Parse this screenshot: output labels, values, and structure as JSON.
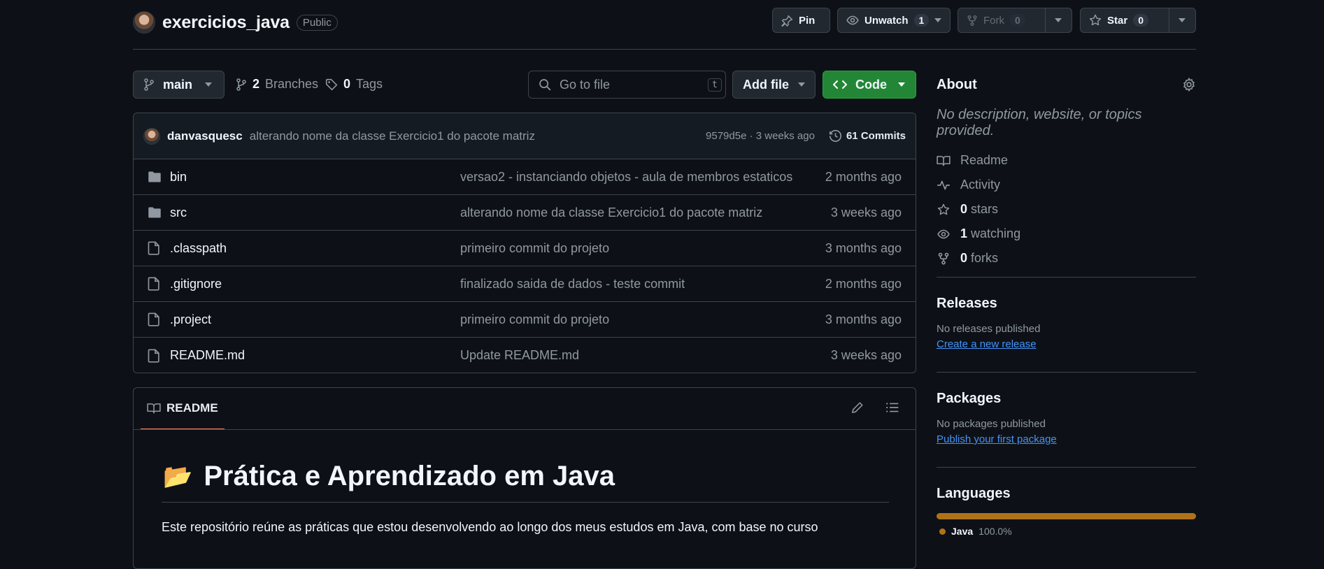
{
  "repo": {
    "name": "exercicios_java",
    "visibility": "Public"
  },
  "header_actions": {
    "pin": "Pin",
    "unwatch": "Unwatch",
    "unwatch_count": "1",
    "fork": "Fork",
    "fork_count": "0",
    "star": "Star",
    "star_count": "0"
  },
  "toolbar": {
    "branch": "main",
    "branches_count": "2",
    "branches_label": "Branches",
    "tags_count": "0",
    "tags_label": "Tags",
    "search_placeholder": "Go to file",
    "search_shortcut": "t",
    "add_file": "Add file",
    "code": "Code"
  },
  "latest_commit": {
    "author": "danvasquesc",
    "message": "alterando nome da classe Exercicio1 do pacote matriz",
    "hash_time": "9579d5e · 3 weeks ago",
    "commits": "61 Commits"
  },
  "files": [
    {
      "name": "bin",
      "type": "folder",
      "message": "versao2 - instanciando objetos - aula de membros estaticos",
      "date": "2 months ago"
    },
    {
      "name": "src",
      "type": "folder",
      "message": "alterando nome da classe Exercicio1 do pacote matriz",
      "date": "3 weeks ago"
    },
    {
      "name": ".classpath",
      "type": "file",
      "message": "primeiro commit do projeto",
      "date": "3 months ago"
    },
    {
      "name": ".gitignore",
      "type": "file",
      "message": "finalizado saida de dados - teste commit",
      "date": "2 months ago"
    },
    {
      "name": ".project",
      "type": "file",
      "message": "primeiro commit do projeto",
      "date": "3 months ago"
    },
    {
      "name": "README.md",
      "type": "file",
      "message": "Update README.md",
      "date": "3 weeks ago"
    }
  ],
  "readme": {
    "tab": "README",
    "emoji": "📂",
    "title": "Prática e Aprendizado em Java",
    "intro": "Este repositório reúne as práticas que estou desenvolvendo ao longo dos meus estudos em Java, com base no curso"
  },
  "about": {
    "title": "About",
    "description": "No description, website, or topics provided.",
    "readme": "Readme",
    "activity": "Activity",
    "stars_count": "0",
    "stars_label": "stars",
    "watching_count": "1",
    "watching_label": "watching",
    "forks_count": "0",
    "forks_label": "forks"
  },
  "releases": {
    "title": "Releases",
    "empty": "No releases published",
    "link": "Create a new release"
  },
  "packages": {
    "title": "Packages",
    "empty": "No packages published",
    "link": "Publish your first package"
  },
  "languages": {
    "title": "Languages",
    "items": [
      {
        "name": "Java",
        "percent": "100.0%",
        "color": "#b07219"
      }
    ]
  }
}
